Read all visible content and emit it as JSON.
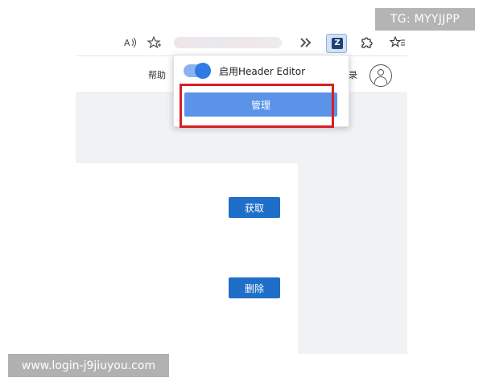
{
  "watermarks": {
    "top": "TG: MYYJJPP",
    "bottom": "www.login-j9jiuyou.com"
  },
  "browser_toolbar": {
    "icons": [
      "read-aloud-icon",
      "add-favorite-icon",
      "forward-chevrons-icon",
      "header-editor-extension-icon",
      "extensions-puzzle-icon",
      "favorites-icon"
    ]
  },
  "page_nav": {
    "help": "帮助",
    "login": "录"
  },
  "popup": {
    "toggle_label": "启用Header Editor",
    "toggle_on": true,
    "manage_button": "管理"
  },
  "content": {
    "get_button": "获取",
    "delete_button": "删除"
  },
  "colors": {
    "accent": "#1f6fc8",
    "manage_button": "#5b93e8",
    "highlight": "#d61f26"
  }
}
